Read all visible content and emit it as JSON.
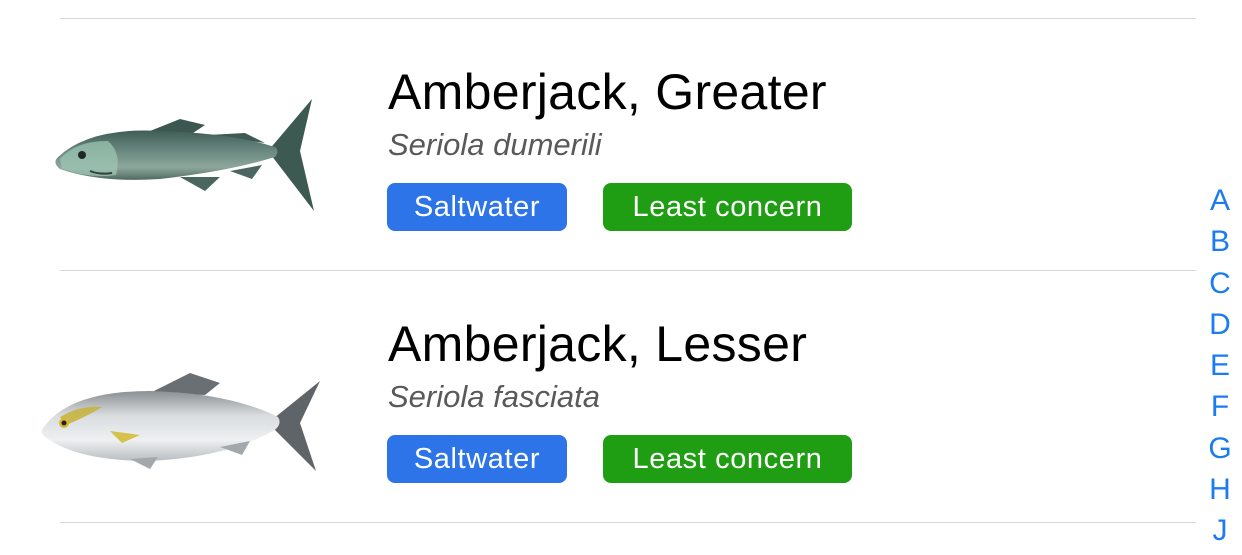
{
  "list": {
    "rows": [
      {
        "common_name": "Amberjack, Greater",
        "scientific_name": "Seriola dumerili",
        "water_badge": "Saltwater",
        "status_badge": "Least concern",
        "image_icon": "fish-greater-amberjack-icon"
      },
      {
        "common_name": "Amberjack, Lesser",
        "scientific_name": "Seriola fasciata",
        "water_badge": "Saltwater",
        "status_badge": "Least concern",
        "image_icon": "fish-lesser-amberjack-icon"
      }
    ]
  },
  "index_bar": {
    "letters": [
      "A",
      "B",
      "C",
      "D",
      "E",
      "F",
      "G",
      "H",
      "J"
    ]
  },
  "colors": {
    "saltwater_badge": "#2d74e8",
    "least_concern_badge": "#1f9e14",
    "index_letters": "#1a7cf0",
    "separator": "#d6d6d8"
  }
}
